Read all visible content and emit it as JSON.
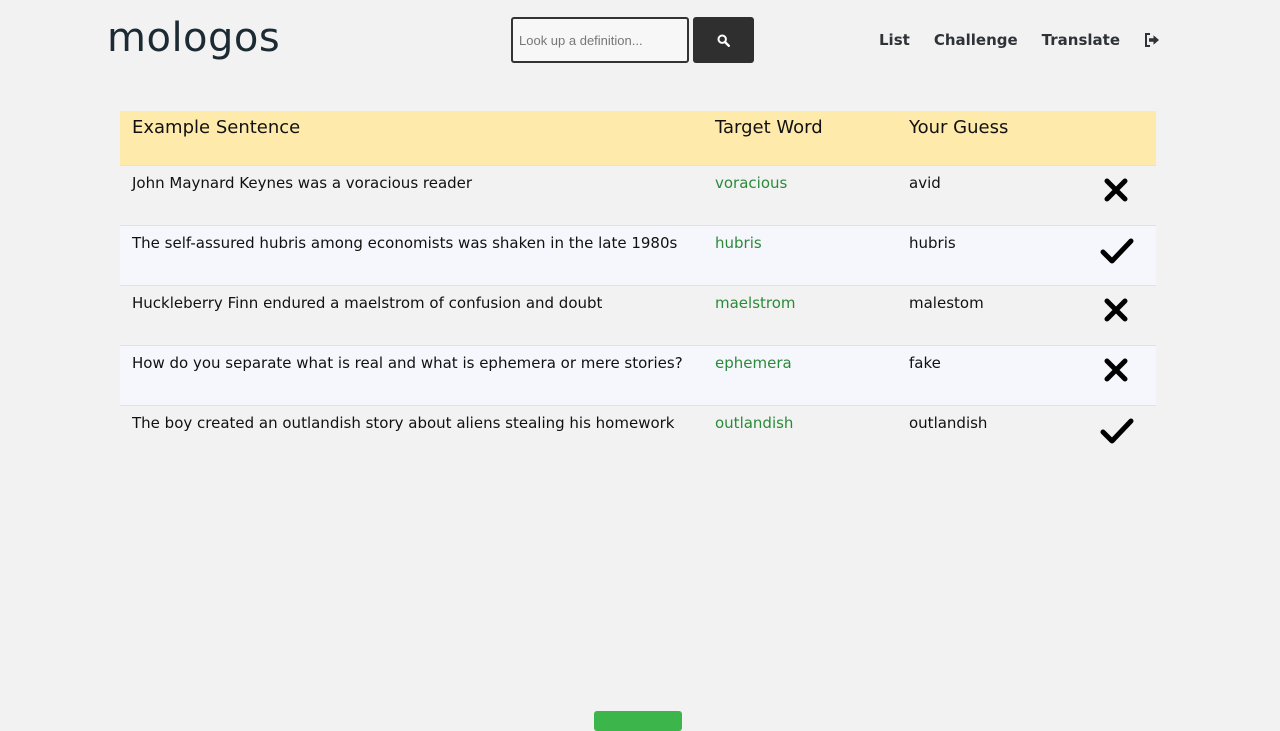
{
  "header": {
    "logo": "mologos",
    "search": {
      "placeholder": "Look up a definition...",
      "value": ""
    },
    "nav": [
      {
        "label": "List"
      },
      {
        "label": "Challenge"
      },
      {
        "label": "Translate"
      }
    ]
  },
  "table": {
    "columns": {
      "sentence": "Example Sentence",
      "target": "Target Word",
      "guess": "Your Guess"
    },
    "rows": [
      {
        "sentence": "John Maynard Keynes was a voracious reader",
        "target": "voracious",
        "guess": "avid",
        "result": "incorrect"
      },
      {
        "sentence": "The self-assured hubris among economists was shaken in the late 1980s",
        "target": "hubris",
        "guess": "hubris",
        "result": "correct"
      },
      {
        "sentence": "Huckleberry Finn endured a maelstrom of confusion and doubt",
        "target": "maelstrom",
        "guess": "malestom",
        "result": "incorrect"
      },
      {
        "sentence": "How do you separate what is real and what is ephemera or mere stories?",
        "target": "ephemera",
        "guess": "fake",
        "result": "incorrect"
      },
      {
        "sentence": "The boy created an outlandish story about aliens stealing his homework",
        "target": "outlandish",
        "guess": "outlandish",
        "result": "correct"
      }
    ]
  },
  "colors": {
    "header_row": "#feeaaa",
    "target_word": "#2b8a3a",
    "bottom_button": "#3cb54a"
  },
  "icons": {
    "search": "search-icon",
    "logout": "sign-out-icon",
    "correct": "check-icon",
    "incorrect": "x-icon"
  }
}
